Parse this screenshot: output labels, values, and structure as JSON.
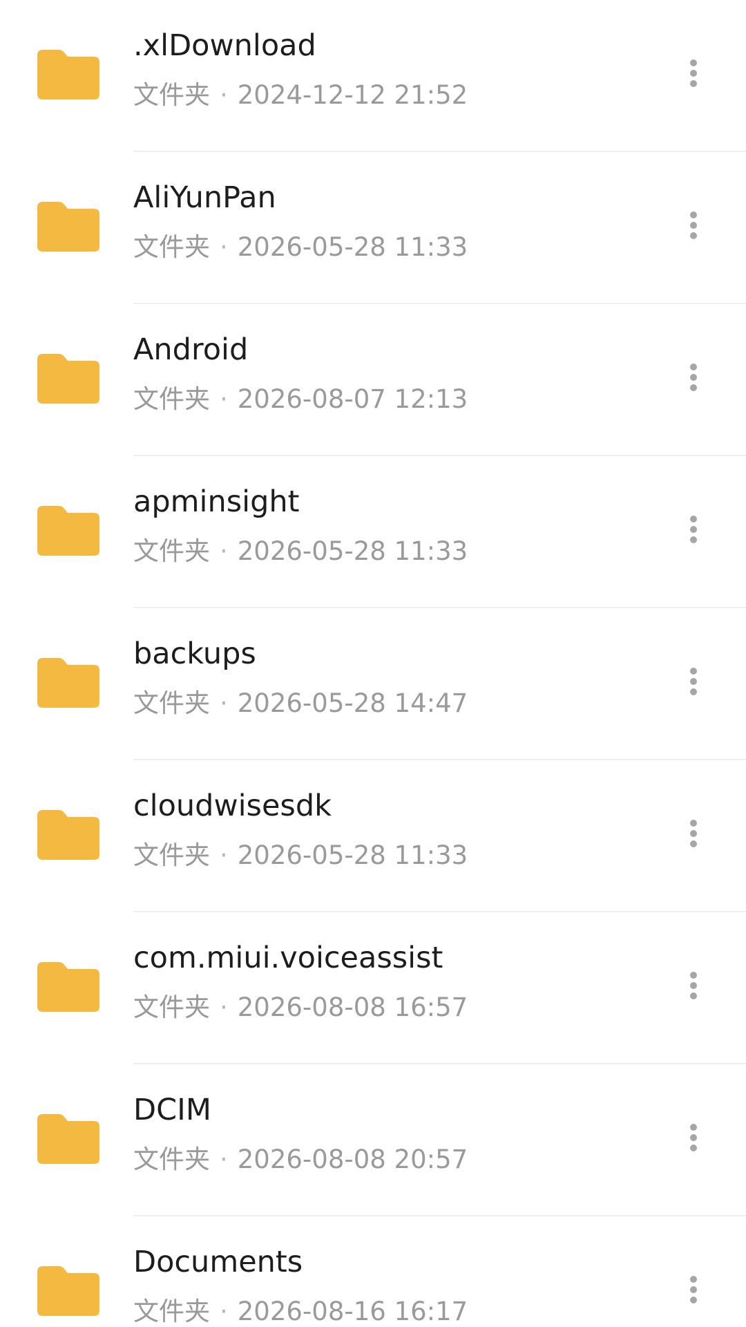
{
  "theme": {
    "folder_color": "#F4B940",
    "name_color": "#1D1D1F",
    "meta_color": "#9A9A9A",
    "divider_color": "#EFEFEF"
  },
  "items": [
    {
      "name": ".xlDownload",
      "type": "文件夹",
      "separator": "·",
      "modified": "2024-12-12 21:52",
      "icon": "folder-icon",
      "action_icon": "more-vertical-icon"
    },
    {
      "name": "AliYunPan",
      "type": "文件夹",
      "separator": "·",
      "modified": "2026-05-28 11:33",
      "icon": "folder-icon",
      "action_icon": "more-vertical-icon"
    },
    {
      "name": "Android",
      "type": "文件夹",
      "separator": "·",
      "modified": "2026-08-07 12:13",
      "icon": "folder-icon",
      "action_icon": "more-vertical-icon"
    },
    {
      "name": "apminsight",
      "type": "文件夹",
      "separator": "·",
      "modified": "2026-05-28 11:33",
      "icon": "folder-icon",
      "action_icon": "more-vertical-icon"
    },
    {
      "name": "backups",
      "type": "文件夹",
      "separator": "·",
      "modified": "2026-05-28 14:47",
      "icon": "folder-icon",
      "action_icon": "more-vertical-icon"
    },
    {
      "name": "cloudwisesdk",
      "type": "文件夹",
      "separator": "·",
      "modified": "2026-05-28 11:33",
      "icon": "folder-icon",
      "action_icon": "more-vertical-icon"
    },
    {
      "name": "com.miui.voiceassist",
      "type": "文件夹",
      "separator": "·",
      "modified": "2026-08-08 16:57",
      "icon": "folder-icon",
      "action_icon": "more-vertical-icon"
    },
    {
      "name": "DCIM",
      "type": "文件夹",
      "separator": "·",
      "modified": "2026-08-08 20:57",
      "icon": "folder-icon",
      "action_icon": "more-vertical-icon"
    },
    {
      "name": "Documents",
      "type": "文件夹",
      "separator": "·",
      "modified": "2026-08-16 16:17",
      "icon": "folder-icon",
      "action_icon": "more-vertical-icon"
    }
  ]
}
